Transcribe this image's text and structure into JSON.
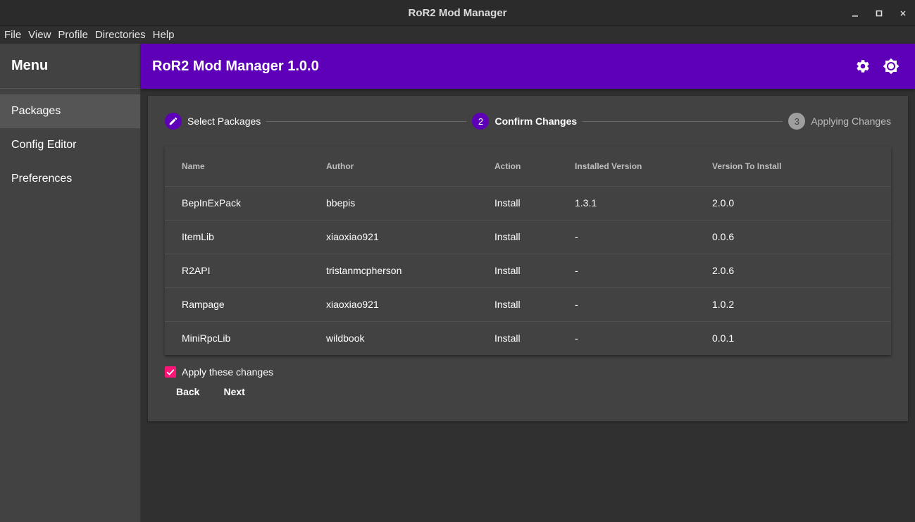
{
  "window": {
    "title": "RoR2 Mod Manager"
  },
  "menubar": {
    "items": [
      "File",
      "View",
      "Profile",
      "Directories",
      "Help"
    ]
  },
  "sidebar": {
    "title": "Menu",
    "items": [
      {
        "label": "Packages",
        "active": true
      },
      {
        "label": "Config Editor",
        "active": false
      },
      {
        "label": "Preferences",
        "active": false
      }
    ]
  },
  "appbar": {
    "title": "RoR2 Mod Manager 1.0.0",
    "icons": [
      "gear-icon",
      "brightness-icon"
    ]
  },
  "stepper": {
    "steps": [
      {
        "label": "Select Packages",
        "state": "done",
        "icon": "pencil-icon"
      },
      {
        "label": "Confirm Changes",
        "state": "active",
        "number": "2"
      },
      {
        "label": "Applying Changes",
        "state": "pending",
        "number": "3"
      }
    ]
  },
  "table": {
    "headers": [
      "Name",
      "Author",
      "Action",
      "Installed Version",
      "Version To Install"
    ],
    "rows": [
      [
        "BepInExPack",
        "bbepis",
        "Install",
        "1.3.1",
        "2.0.0"
      ],
      [
        "ItemLib",
        "xiaoxiao921",
        "Install",
        "-",
        "0.0.6"
      ],
      [
        "R2API",
        "tristanmcpherson",
        "Install",
        "-",
        "2.0.6"
      ],
      [
        "Rampage",
        "xiaoxiao921",
        "Install",
        "-",
        "1.0.2"
      ],
      [
        "MiniRpcLib",
        "wildbook",
        "Install",
        "-",
        "0.0.1"
      ]
    ]
  },
  "apply": {
    "label": "Apply these changes",
    "checked": true
  },
  "buttons": {
    "back": "Back",
    "next": "Next"
  },
  "colors": {
    "accent": "#5e00b8",
    "checkbox": "#ff1478",
    "background": "#303030",
    "surface": "#424242"
  }
}
